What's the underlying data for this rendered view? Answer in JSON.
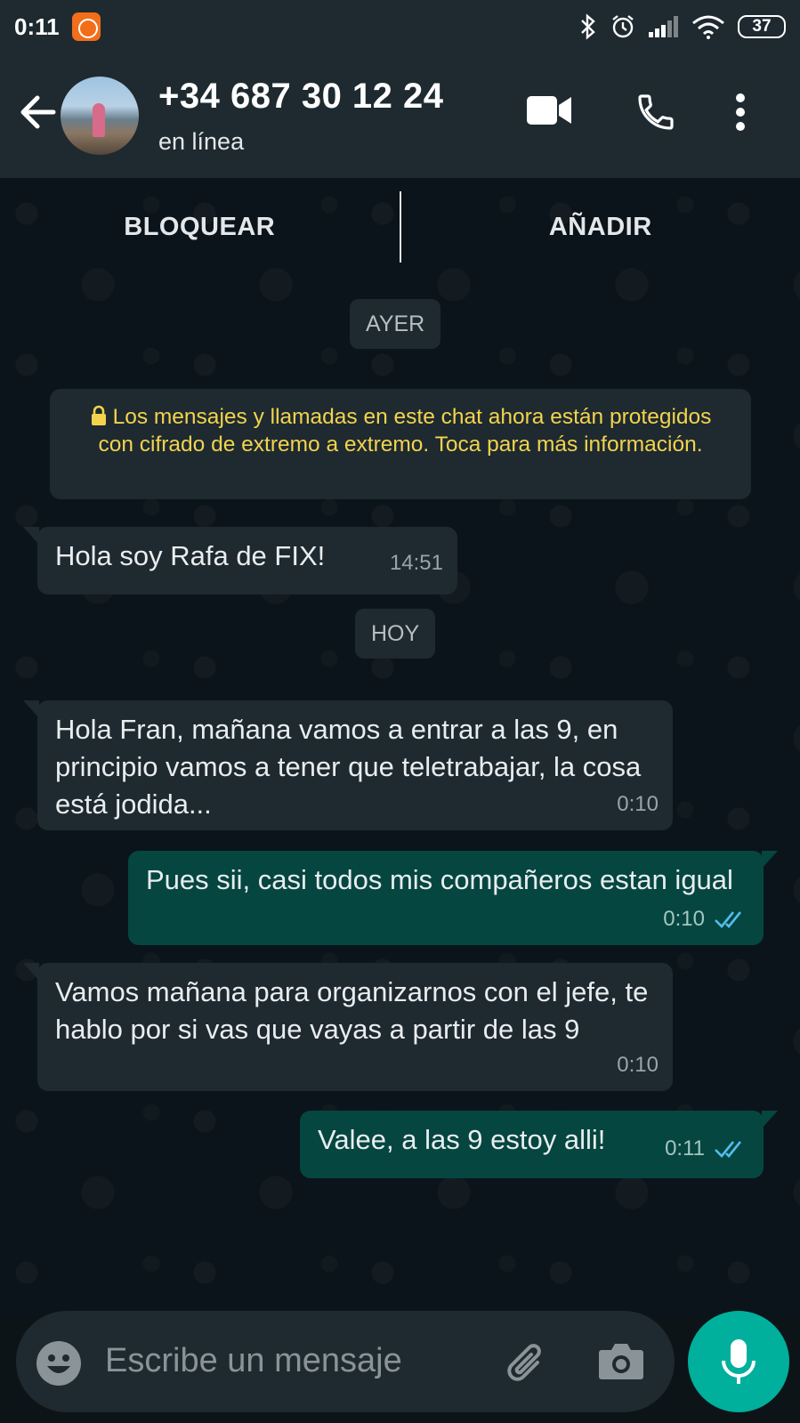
{
  "status_bar": {
    "time": "0:11",
    "battery": "37",
    "icons": [
      "mi-app-icon",
      "bluetooth-icon",
      "alarm-icon",
      "signal-icon",
      "wifi-icon",
      "battery-icon"
    ]
  },
  "header": {
    "contact_name": "+34 687 30 12 24",
    "contact_status": "en línea",
    "icons": [
      "back-arrow-icon",
      "video-call-icon",
      "phone-icon",
      "more-vert-icon"
    ]
  },
  "actions": {
    "block_label": "BLOQUEAR",
    "add_label": "AÑADIR"
  },
  "chat": {
    "date_yesterday": "AYER",
    "date_today": "HOY",
    "encryption_notice": "Los mensajes y llamadas en este chat ahora están protegidos con cifrado de extremo a extremo. Toca para más información.",
    "messages": [
      {
        "direction": "in",
        "text": "Hola soy Rafa de FIX!",
        "time": "14:51"
      },
      {
        "direction": "in",
        "text": "Hola Fran, mañana vamos a entrar a las 9, en principio vamos a tener que teletrabajar, la cosa está jodida...",
        "time": "0:10"
      },
      {
        "direction": "out",
        "text": "Pues sii, casi todos mis compañeros estan igual",
        "time": "0:10",
        "status": "read"
      },
      {
        "direction": "in",
        "text": "Vamos mañana para organizarnos con el jefe, te hablo por si vas que vayas a partir de las 9",
        "time": "0:10"
      },
      {
        "direction": "out",
        "text": "Valee, a las 9 estoy alli!",
        "time": "0:11",
        "status": "read"
      }
    ]
  },
  "composer": {
    "placeholder": "Escribe un mensaje",
    "value": ""
  },
  "colors": {
    "header_bg": "#1e2a30",
    "chat_bg": "#0b141a",
    "incoming_bubble": "#1e2a30",
    "outgoing_bubble": "#054640",
    "read_ticks": "#53bdeb",
    "notice_text": "#f3d34d",
    "mic_button": "#00af9c"
  }
}
